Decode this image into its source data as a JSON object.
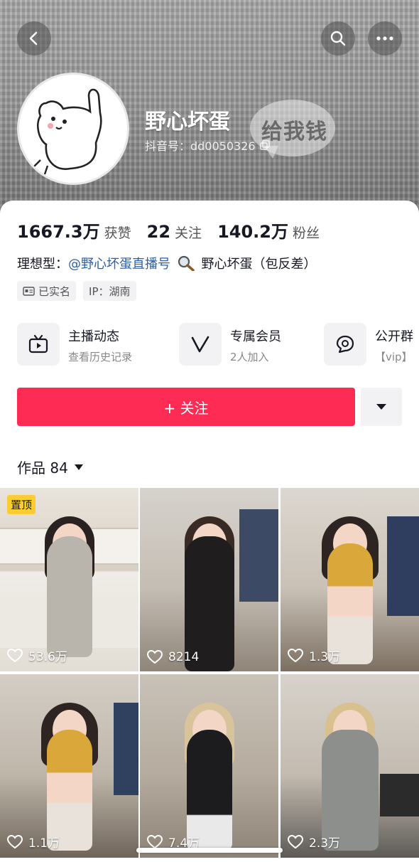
{
  "header": {
    "back_icon": "chevron-left-icon",
    "search_icon": "search-icon",
    "more_icon": "more-dots-icon",
    "banner_text": "给我钱",
    "name": "野心坏蛋",
    "douyin_id": "抖音号：dd0050326"
  },
  "stats": [
    {
      "value": "1667.3万",
      "label": "获赞"
    },
    {
      "value": "22",
      "label": "关注"
    },
    {
      "value": "140.2万",
      "label": "粉丝"
    }
  ],
  "bio": {
    "prefix": "理想型：",
    "link": "@野心坏蛋直播号",
    "suffix": "野心坏蛋（包反差）"
  },
  "tags": [
    {
      "label": "已实名",
      "icon": "id-card-icon"
    },
    {
      "label": "IP：湖南"
    }
  ],
  "features": [
    {
      "title": "主播动态",
      "subtitle": "查看历史记录",
      "icon": "tv-icon"
    },
    {
      "title": "专属会员",
      "subtitle": "2人加入",
      "icon": "v-badge-icon"
    },
    {
      "title": "公开群",
      "subtitle": "【vip】",
      "icon": "chat-group-icon"
    }
  ],
  "follow_button": "+ 关注",
  "works": {
    "label": "作品 84"
  },
  "videos": [
    {
      "likes": "53.6万",
      "pinned": "置顶"
    },
    {
      "likes": "8214"
    },
    {
      "likes": "1.3万"
    },
    {
      "likes": "1.1万"
    },
    {
      "likes": "7.4万"
    },
    {
      "likes": "2.3万"
    }
  ],
  "colors": {
    "accent": "#fe2c55",
    "link": "#2b5fa8",
    "pinned": "#facd34"
  }
}
